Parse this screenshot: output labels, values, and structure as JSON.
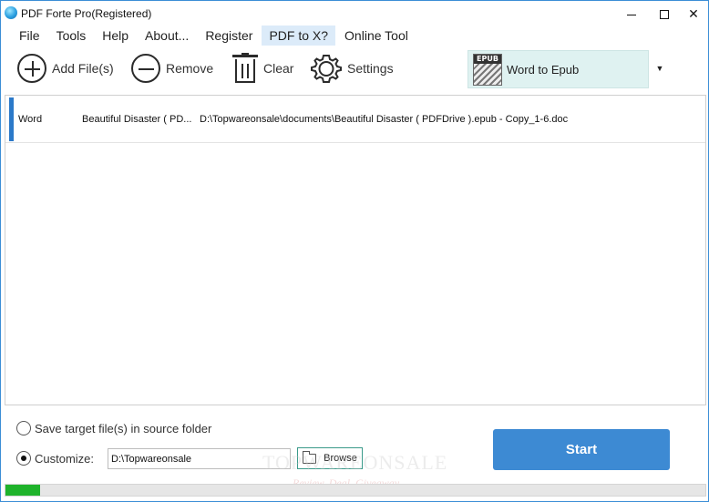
{
  "window": {
    "title": "PDF Forte Pro(Registered)",
    "controls": {
      "minimize": "",
      "maximize": "",
      "close": "✕"
    }
  },
  "menu": {
    "items": [
      {
        "label": "File"
      },
      {
        "label": "Tools"
      },
      {
        "label": "Help"
      },
      {
        "label": "About..."
      },
      {
        "label": "Register"
      },
      {
        "label": "PDF to X?"
      },
      {
        "label": "Online Tool"
      }
    ],
    "active_index": 5
  },
  "toolbar": {
    "add_label": "Add File(s)",
    "remove_label": "Remove",
    "clear_label": "Clear",
    "settings_label": "Settings",
    "format": {
      "label": "Word to Epub",
      "icon_tag": "EPUB",
      "dropdown_arrow": "▼"
    }
  },
  "files": [
    {
      "type": "Word",
      "name": "Beautiful Disaster ( PD...",
      "path": "D:\\Topwareonsale\\documents\\Beautiful Disaster ( PDFDrive ).epub - Copy_1-6.doc"
    }
  ],
  "output": {
    "source_folder_label": "Save target file(s) in source folder",
    "source_folder_checked": false,
    "customize_label": "Customize:",
    "customize_checked": true,
    "path_value": "D:\\Topwareonsale",
    "browse_label": "Browse"
  },
  "watermark": {
    "main": "TOPWAREONSALE",
    "sub": "Review. Deal. Giveaway"
  },
  "start_label": "Start",
  "progress": {
    "percent": 5
  },
  "colors": {
    "accent": "#3d8ad3",
    "progress": "#1fb32b",
    "selection": "#2b79c9",
    "format_bg": "#dff2f1"
  }
}
